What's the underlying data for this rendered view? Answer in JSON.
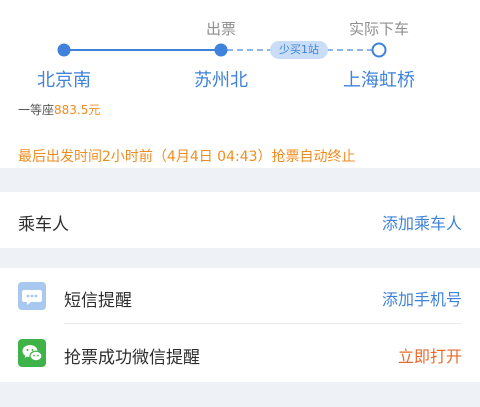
{
  "route": {
    "depart_station": "北京南",
    "transfer_caption": "出票",
    "transfer_station": "苏州北",
    "remaining_stops": "少买1站",
    "arrive_caption": "实际下车",
    "arrive_station": "上海虹桥"
  },
  "seat": {
    "type": "一等座",
    "price": "883.5元"
  },
  "notice": "最后出发时间2小时前（4月4日 04:43）抢票自动终止",
  "passenger_row": {
    "label": "乘车人",
    "action": "添加乘车人"
  },
  "sms_row": {
    "label": "短信提醒",
    "action": "添加手机号",
    "icon": "message-icon",
    "icon_color": "#a9c8ef"
  },
  "wechat_row": {
    "label": "抢票成功微信提醒",
    "action": "立即打开",
    "icon": "wechat-icon",
    "icon_color": "#3fb34a"
  },
  "colors": {
    "accent": "#3e82db",
    "warning": "#f08c1f",
    "action_orange": "#ea6a2a",
    "separator": "#eef1f5"
  }
}
